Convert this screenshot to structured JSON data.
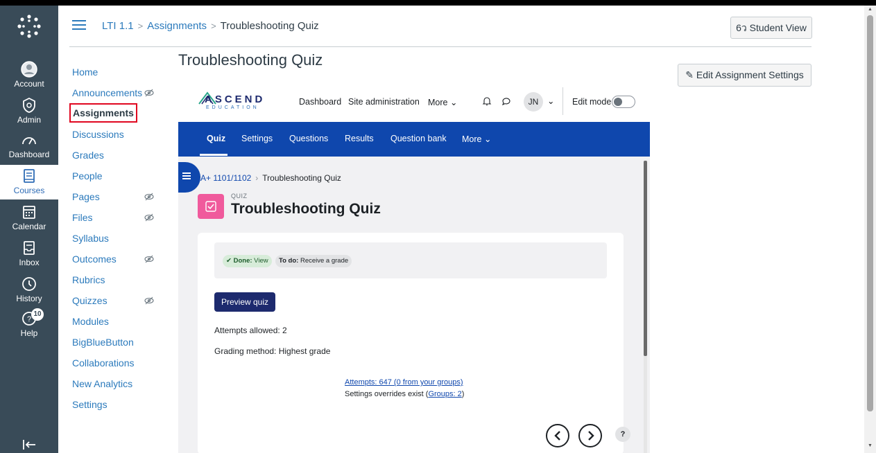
{
  "global_nav": {
    "items": [
      {
        "label": "Account",
        "icon": "user-circle-icon"
      },
      {
        "label": "Admin",
        "icon": "shield-icon"
      },
      {
        "label": "Dashboard",
        "icon": "dashboard-gauge-icon"
      },
      {
        "label": "Courses",
        "icon": "book-icon"
      },
      {
        "label": "Calendar",
        "icon": "calendar-icon"
      },
      {
        "label": "Inbox",
        "icon": "inbox-icon"
      },
      {
        "label": "History",
        "icon": "clock-icon"
      },
      {
        "label": "Help",
        "icon": "help-icon",
        "badge": "10"
      }
    ],
    "active": "Courses",
    "bg_color": "#394b58"
  },
  "breadcrumb": {
    "course": "LTI 1.1",
    "section": "Assignments",
    "current": "Troubleshooting Quiz",
    "separator": ">"
  },
  "header": {
    "student_view_label": "Student View"
  },
  "course_nav": {
    "items": [
      {
        "label": "Home"
      },
      {
        "label": "Announcements",
        "hidden": true
      },
      {
        "label": "Assignments",
        "selected": true
      },
      {
        "label": "Discussions"
      },
      {
        "label": "Grades"
      },
      {
        "label": "People"
      },
      {
        "label": "Pages",
        "hidden": true
      },
      {
        "label": "Files",
        "hidden": true
      },
      {
        "label": "Syllabus"
      },
      {
        "label": "Outcomes",
        "hidden": true
      },
      {
        "label": "Rubrics"
      },
      {
        "label": "Quizzes",
        "hidden": true
      },
      {
        "label": "Modules"
      },
      {
        "label": "BigBlueButton"
      },
      {
        "label": "Collaborations"
      },
      {
        "label": "New Analytics"
      },
      {
        "label": "Settings"
      }
    ]
  },
  "main": {
    "title": "Troubleshooting Quiz",
    "edit_settings_label": "Edit Assignment Settings"
  },
  "moodle": {
    "logo_text": "ASCEND",
    "logo_sub": "EDUCATION",
    "nav": {
      "dashboard": "Dashboard",
      "site_admin": "Site administration",
      "more": "More",
      "avatar_initials": "JN",
      "edit_mode": "Edit mode"
    },
    "tabs": [
      "Quiz",
      "Settings",
      "Questions",
      "Results",
      "Question bank",
      "More"
    ],
    "active_tab": "Quiz",
    "brand_color": "#0f47ad",
    "crumb": {
      "course": "A+ 1101/1102",
      "current": "Troubleshooting Quiz"
    },
    "activity_label": "QUIZ",
    "activity_title": "Troubleshooting Quiz",
    "status": {
      "done_label": "Done:",
      "done_value": "View",
      "todo_label": "To do:",
      "todo_value": "Receive a grade"
    },
    "preview_button": "Preview quiz",
    "attempts_allowed": "Attempts allowed: 2",
    "grading_method": "Grading method: Highest grade",
    "attempts_link": "Attempts: 647 (0 from your groups)",
    "overrides_text": "Settings overrides exist (",
    "overrides_link": "Groups: 2",
    "overrides_close": ")",
    "help_label": "?"
  }
}
